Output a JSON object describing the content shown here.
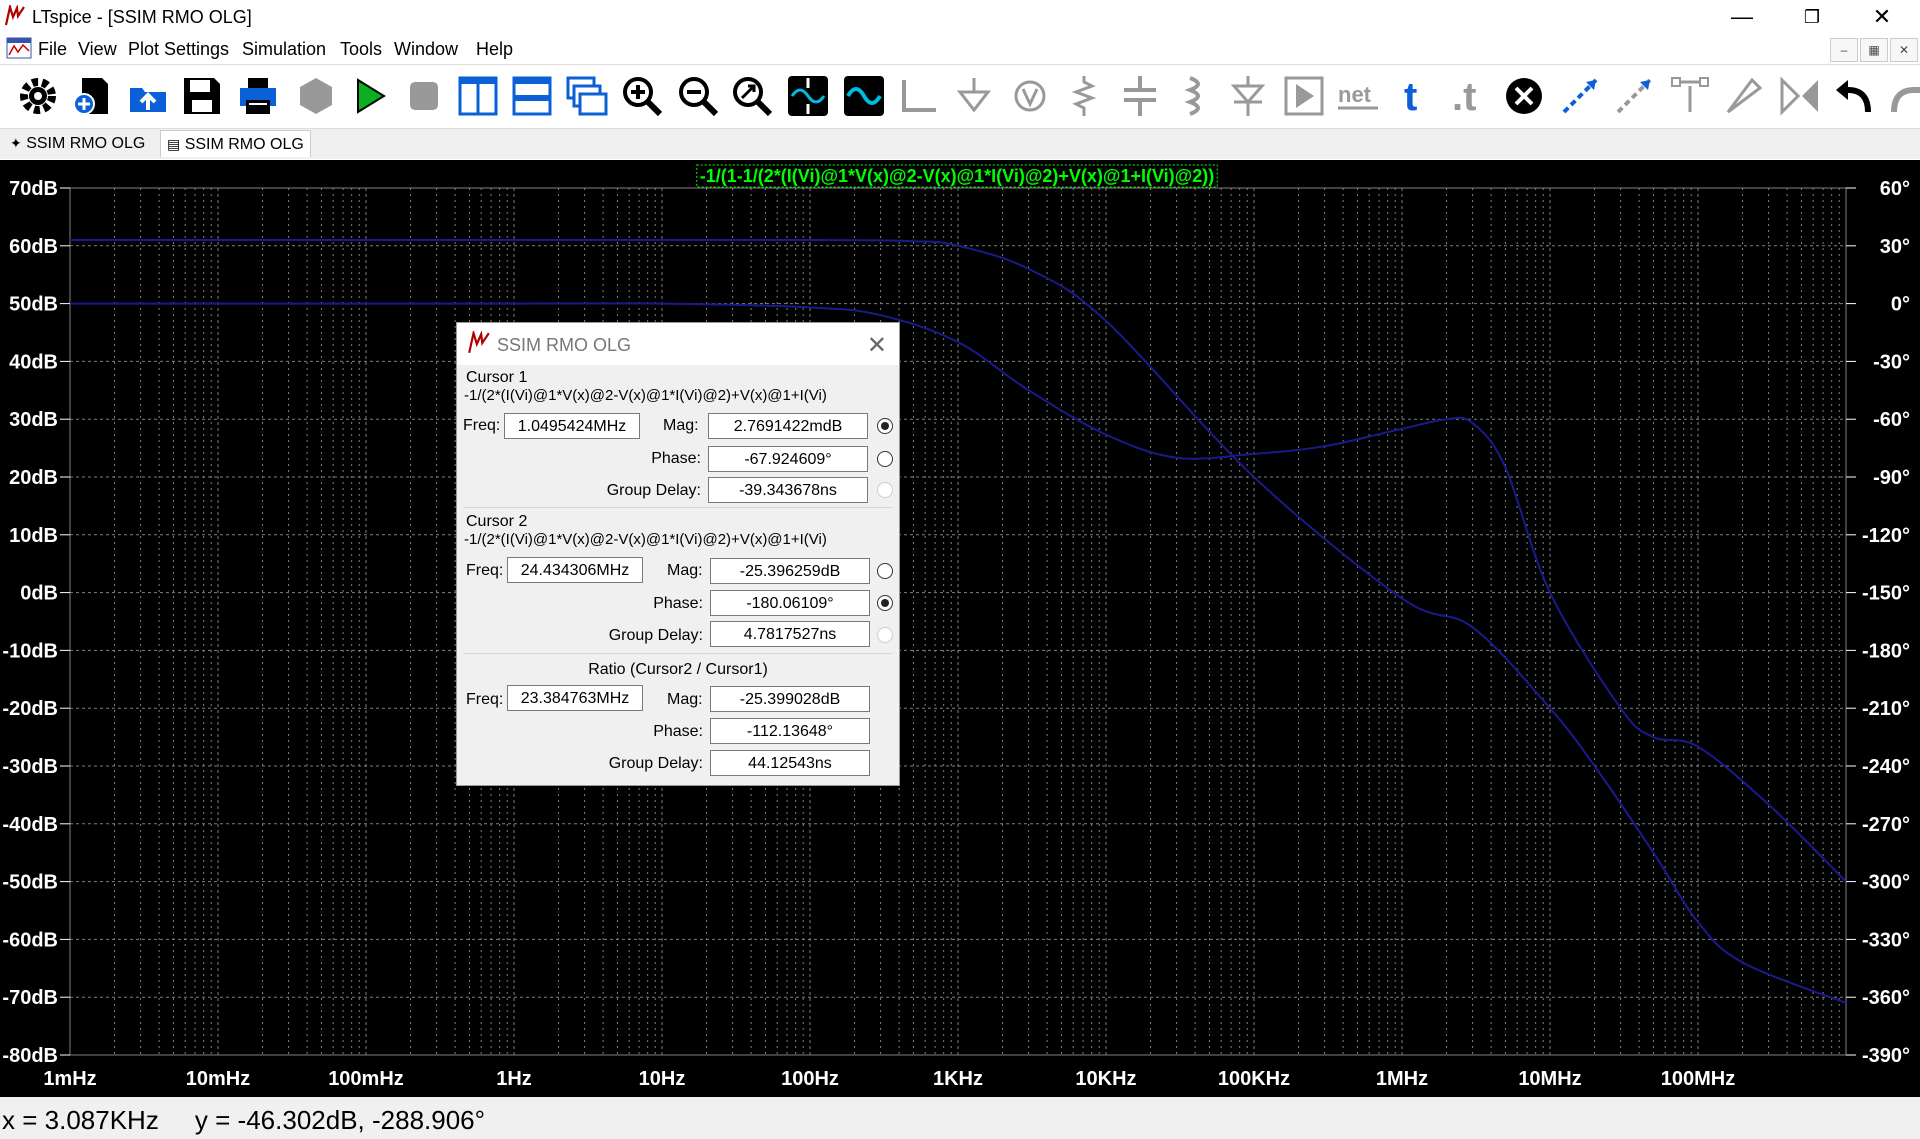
{
  "window": {
    "title": "LTspice - [SSIM RMO OLG]"
  },
  "menu": [
    "File",
    "View",
    "Plot Settings",
    "Simulation",
    "Tools",
    "Window",
    "Help"
  ],
  "toolbar_icons": [
    "gear-icon",
    "new-schematic-icon",
    "open-icon",
    "save-icon",
    "print-icon",
    "hierarchy-icon",
    "run-icon",
    "halt-icon",
    "tile-vertical-icon",
    "tile-horizontal-icon",
    "cascade-icon",
    "zoom-in-icon",
    "zoom-out-icon",
    "zoom-fit-icon",
    "autorange-icon",
    "waveform-icon",
    "wire-icon",
    "ground-icon",
    "label-icon",
    "resistor-icon",
    "capacitor-icon",
    "inductor-icon",
    "diode-icon",
    "component-icon",
    "netlist-icon",
    "text-icon",
    "spice-directive-icon",
    "delete-icon",
    "move-icon",
    "drag-icon",
    "copy-icon",
    "paste-icon",
    "mirror-icon",
    "undo-icon",
    "redo-icon"
  ],
  "toolbar_text": {
    "net": "net",
    "text_t": "t",
    "directive_t": ".t"
  },
  "tabs": [
    "SSIM RMO OLG",
    "SSIM RMO OLG"
  ],
  "plot": {
    "trace_label": "-1/(1-1/(2*(I(Vi)@1*V(x)@2-V(x)@1*I(Vi)@2)+V(x)@1+I(Vi)@2))",
    "trace_label_color": "#00ff00",
    "trace_color": "#1a1a8c",
    "grid_color": "#808080",
    "y_left_labels": [
      "70dB",
      "60dB",
      "50dB",
      "40dB",
      "30dB",
      "20dB",
      "10dB",
      "0dB",
      "-10dB",
      "-20dB",
      "-30dB",
      "-40dB",
      "-50dB",
      "-60dB",
      "-70dB",
      "-80dB"
    ],
    "y_right_labels": [
      "60°",
      "30°",
      "0°",
      "-30°",
      "-60°",
      "-90°",
      "-120°",
      "-150°",
      "-180°",
      "-210°",
      "-240°",
      "-270°",
      "-300°",
      "-330°",
      "-360°",
      "-390°"
    ],
    "x_labels": [
      "1mHz",
      "10mHz",
      "100mHz",
      "1Hz",
      "10Hz",
      "100Hz",
      "1KHz",
      "10KHz",
      "100KHz",
      "1MHz",
      "10MHz",
      "100MHz"
    ]
  },
  "chart_data": {
    "type": "line",
    "xscale": "log",
    "xlim_hz": [
      0.001,
      1000000000
    ],
    "ylim_db": [
      -80,
      70
    ],
    "ylim_deg": [
      -390,
      60
    ],
    "series": [
      {
        "name": "-1/(1-1/(2*(I(Vi)@1*V(x)@2-V(x)@1*I(Vi)@2)+V(x)@1+I(Vi)@2))",
        "axis": "magnitude",
        "x": [
          0.001,
          1,
          100,
          500,
          1000,
          3000,
          10000,
          100000,
          1000000,
          3000000,
          10000000,
          20000000,
          50000000,
          100000000,
          200000000,
          1000000000
        ],
        "y": [
          61,
          61,
          61,
          60.8,
          60,
          56,
          47,
          20,
          -1,
          -6,
          -20,
          -30,
          -45,
          -57,
          -64,
          -71
        ]
      },
      {
        "name": "-1/(1-1/(2*(I(Vi)@1*V(x)@2-V(x)@1*I(Vi)@2)+V(x)@1+I(Vi)@2))",
        "axis": "phase",
        "x": [
          0.001,
          1,
          10,
          100,
          300,
          1000,
          3000,
          10000,
          30000,
          100000,
          300000,
          1000000,
          2000000,
          3000000,
          5000000,
          10000000,
          30000000,
          50000000,
          100000000,
          300000000,
          1000000000
        ],
        "y": [
          0,
          0,
          0,
          -2,
          -6,
          -20,
          -45,
          -68,
          -80,
          -78,
          -74,
          -65,
          -60,
          -62,
          -85,
          -150,
          -210,
          -225,
          -230,
          -260,
          -300
        ]
      }
    ]
  },
  "cursor_dialog": {
    "title": "SSIM RMO OLG",
    "cursor1": {
      "heading": "Cursor 1",
      "expr": "-1/(2*(I(Vi)@1*V(x)@2-V(x)@1*I(Vi)@2)+V(x)@1+I(Vi)",
      "freq": "1.0495424MHz",
      "mag": "2.7691422mdB",
      "phase": "-67.924609°",
      "group_delay": "-39.343678ns"
    },
    "cursor2": {
      "heading": "Cursor 2",
      "expr": "-1/(2*(I(Vi)@1*V(x)@2-V(x)@1*I(Vi)@2)+V(x)@1+I(Vi)",
      "freq": "24.434306MHz",
      "mag": "-25.396259dB",
      "phase": "-180.06109°",
      "group_delay": "4.7817527ns"
    },
    "ratio": {
      "heading": "Ratio (Cursor2 / Cursor1)",
      "freq": "23.384763MHz",
      "mag": "-25.399028dB",
      "phase": "-112.13648°",
      "group_delay": "44.12543ns"
    },
    "labels": {
      "freq": "Freq:",
      "mag": "Mag:",
      "phase": "Phase:",
      "group_delay": "Group Delay:"
    }
  },
  "status": {
    "text": "x = 3.087KHz     y = -46.302dB, -288.906°"
  }
}
